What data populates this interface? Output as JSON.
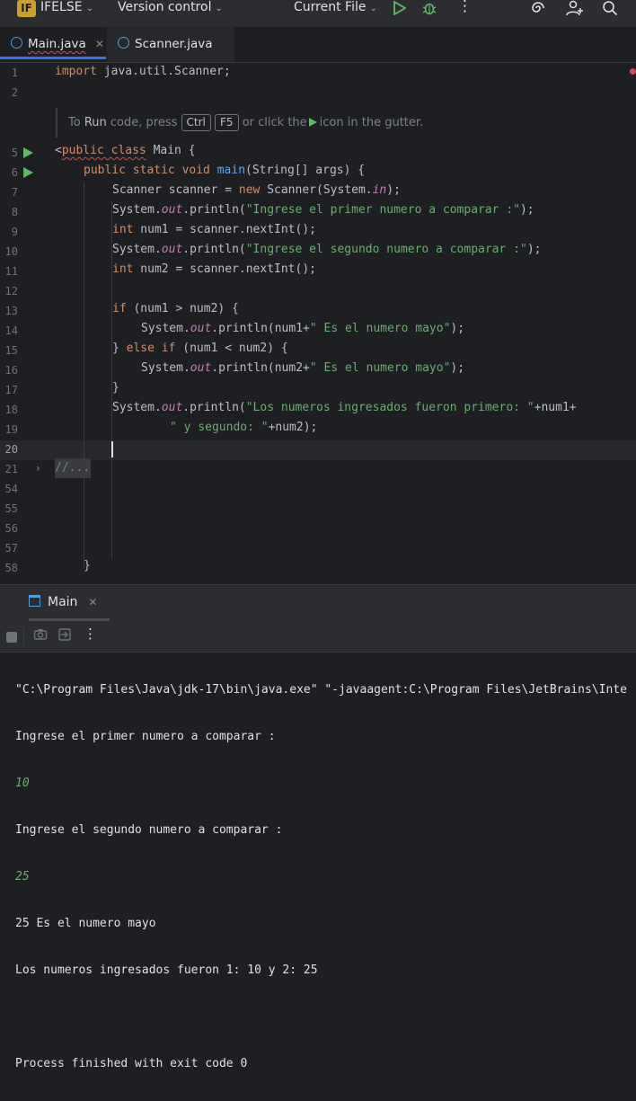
{
  "titlebar": {
    "project_badge": "IF",
    "project_name": "IFELSE",
    "version_control": "Version control",
    "run_config": "Current File"
  },
  "tabs": [
    {
      "label": "Main.java",
      "active": true
    },
    {
      "label": "Scanner.java",
      "active": false
    }
  ],
  "hint": {
    "to": "To",
    "run": "Run",
    "code_press": "code, press",
    "key1": "Ctrl",
    "key2": "F5",
    "or_click": "or click the",
    "icon_in_gutter": "icon in the gutter."
  },
  "line_numbers": [
    "1",
    "2",
    "5",
    "6",
    "7",
    "8",
    "9",
    "10",
    "11",
    "12",
    "13",
    "14",
    "15",
    "16",
    "17",
    "18",
    "19",
    "20",
    "21",
    "54",
    "55",
    "56",
    "57",
    "58"
  ],
  "code": {
    "l1_kw": "import",
    "l1_rest": " java.util.Scanner;",
    "l5_lt": "<",
    "l5_kw": "public class",
    "l5_rest": " Main {",
    "l6_kw": "public static void",
    "l6_fn": "main",
    "l6_rest": "(String[] args) {",
    "l7_a": "Scanner scanner = ",
    "l7_kw": "new",
    "l7_b": " Scanner(System.",
    "l7_fld": "in",
    "l7_c": ");",
    "sys": "System.",
    "out": "out",
    "println_open": ".println(",
    "l8_str": "\"Ingrese el primer numero a comparar :\"",
    "close_semi": ");",
    "int_kw": "int",
    "l9_rest": " num1 = scanner.nextInt();",
    "l10_str": "\"Ingrese el segundo numero a comparar :\"",
    "l11_rest": " num2 = scanner.nextInt();",
    "if_kw": "if",
    "l13_rest": " (num1 > num2) {",
    "l14_a": "num1+",
    "mayo_str": "\" Es el numero mayo\"",
    "l15_a": "} ",
    "else_if_kw": "else if",
    "l15_b": " (num1 < num2) {",
    "l16_a": "num2+",
    "l17": "}",
    "l18_str": "\"Los numeros ingresados fueron primero: \"",
    "l18_rest": "+num1+",
    "l19_str": "\" y segundo: \"",
    "l19_rest": "+num2);",
    "folded": "//...",
    "l58": "}"
  },
  "run_panel": {
    "tab_label": "Main"
  },
  "console": {
    "cmd": "\"C:\\Program Files\\Java\\jdk-17\\bin\\java.exe\" \"-javaagent:C:\\Program Files\\JetBrains\\Inte",
    "prompt1": "Ingrese el primer numero a comparar :",
    "input1": "10",
    "prompt2": "Ingrese el segundo numero a comparar :",
    "input2": "25",
    "result": "25 Es el numero mayo",
    "summary": "Los numeros ingresados fueron 1: 10 y 2: 25",
    "exit": "Process finished with exit code 0"
  }
}
